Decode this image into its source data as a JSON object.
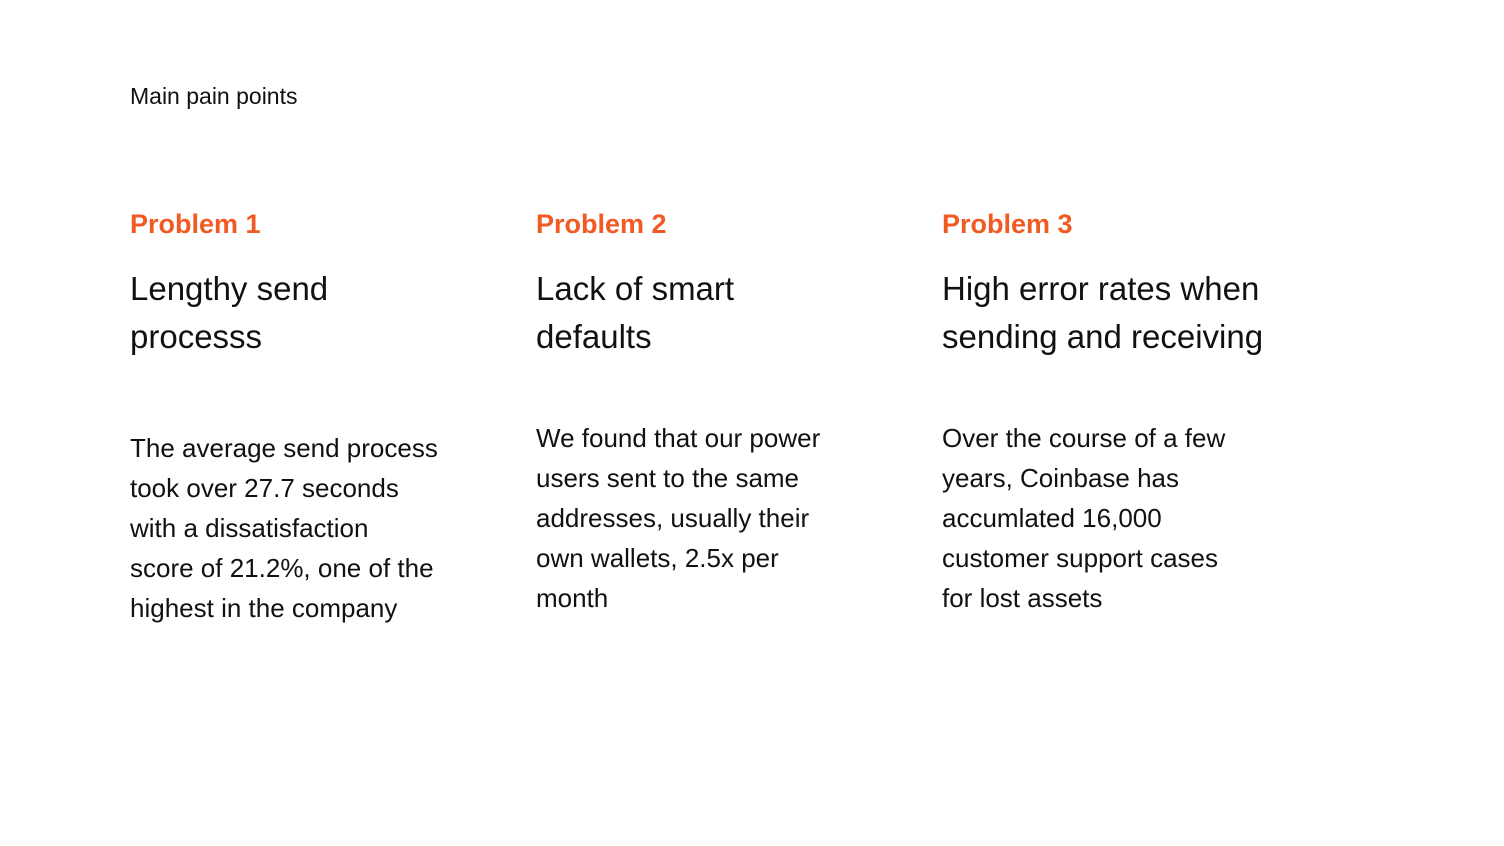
{
  "header": {
    "label": "Main pain points"
  },
  "problems": [
    {
      "tag": "Problem 1",
      "title_lines": [
        "Lengthy send",
        "processs"
      ],
      "desc_lines": [
        "The average send process",
        "took over 27.7 seconds",
        "with a dissatisfaction",
        "score of 21.2%, one of the",
        "highest in the company"
      ]
    },
    {
      "tag": "Problem 2",
      "title_lines": [
        "Lack of smart",
        "defaults"
      ],
      "desc_lines": [
        "We found that our power",
        "users sent to the same",
        "addresses, usually their",
        "own wallets, 2.5x per",
        "month"
      ]
    },
    {
      "tag": "Problem 3",
      "title_lines": [
        "High error rates when",
        "sending and receiving"
      ],
      "desc_lines": [
        "Over the course of a few",
        "years, Coinbase has",
        "accumlated 16,000",
        "customer support cases",
        "for lost assets"
      ]
    }
  ],
  "colors": {
    "accent": "#f15a22",
    "text": "#111111",
    "background": "#ffffff"
  }
}
